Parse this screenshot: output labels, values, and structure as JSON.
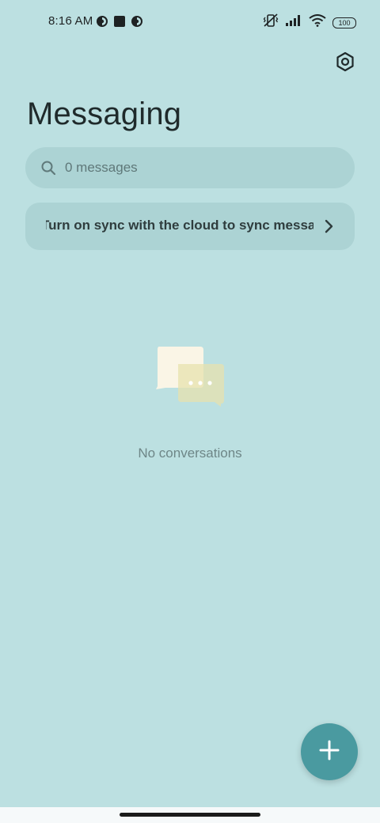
{
  "status_bar": {
    "time": "8:16 AM",
    "left_icons": [
      "vpn-icon",
      "square-icon",
      "vpn-icon"
    ],
    "right_icons": [
      "vibrate-off-icon",
      "signal-icon",
      "wifi-icon",
      "battery-icon"
    ],
    "battery_level": "100"
  },
  "header": {
    "settings_icon": "gear-hex-icon",
    "title": "Messaging"
  },
  "search": {
    "placeholder": "0 messages",
    "icon": "search-icon"
  },
  "sync_banner": {
    "text": "Turn on sync with the cloud to sync messages",
    "chevron_icon": "chevron-right-icon"
  },
  "empty_state": {
    "illustration": "chat-bubbles-icon",
    "text": "No conversations"
  },
  "fab": {
    "icon": "plus-icon"
  },
  "colors": {
    "background": "#bce0e1",
    "surface": "#acd3d4",
    "fab": "#4a9aa0",
    "title": "#1f2a2b",
    "muted_text": "#6e8687"
  }
}
